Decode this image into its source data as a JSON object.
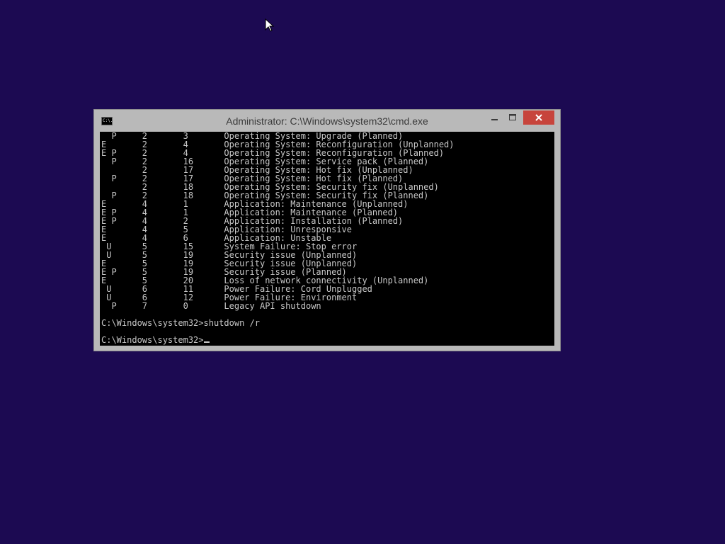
{
  "window": {
    "title": "Administrator: C:\\Windows\\system32\\cmd.exe",
    "icon_text": "C:\\."
  },
  "console": {
    "lines": [
      "  P     2       3       Operating System: Upgrade (Planned)",
      "E       2       4       Operating System: Reconfiguration (Unplanned)",
      "E P     2       4       Operating System: Reconfiguration (Planned)",
      "  P     2       16      Operating System: Service pack (Planned)",
      "        2       17      Operating System: Hot fix (Unplanned)",
      "  P     2       17      Operating System: Hot fix (Planned)",
      "        2       18      Operating System: Security fix (Unplanned)",
      "  P     2       18      Operating System: Security fix (Planned)",
      "E       4       1       Application: Maintenance (Unplanned)",
      "E P     4       1       Application: Maintenance (Planned)",
      "E P     4       2       Application: Installation (Planned)",
      "E       4       5       Application: Unresponsive",
      "E       4       6       Application: Unstable",
      " U      5       15      System Failure: Stop error",
      " U      5       19      Security issue (Unplanned)",
      "E       5       19      Security issue (Unplanned)",
      "E P     5       19      Security issue (Planned)",
      "E       5       20      Loss of network connectivity (Unplanned)",
      " U      6       11      Power Failure: Cord Unplugged",
      " U      6       12      Power Failure: Environment",
      "  P     7       0       Legacy API shutdown",
      "",
      "C:\\Windows\\system32>shutdown /r",
      ""
    ],
    "prompt": "C:\\Windows\\system32>"
  },
  "colors": {
    "desktop_background": "#1c0a52",
    "window_frame": "#b9b9b9",
    "close_button": "#c7443c",
    "console_background": "#000000",
    "console_text": "#c8c8c8"
  },
  "icons": {
    "app": "cmd-icon",
    "minimize": "minimize-icon",
    "maximize": "maximize-icon",
    "close": "close-icon",
    "pointer": "mouse-pointer-icon"
  }
}
